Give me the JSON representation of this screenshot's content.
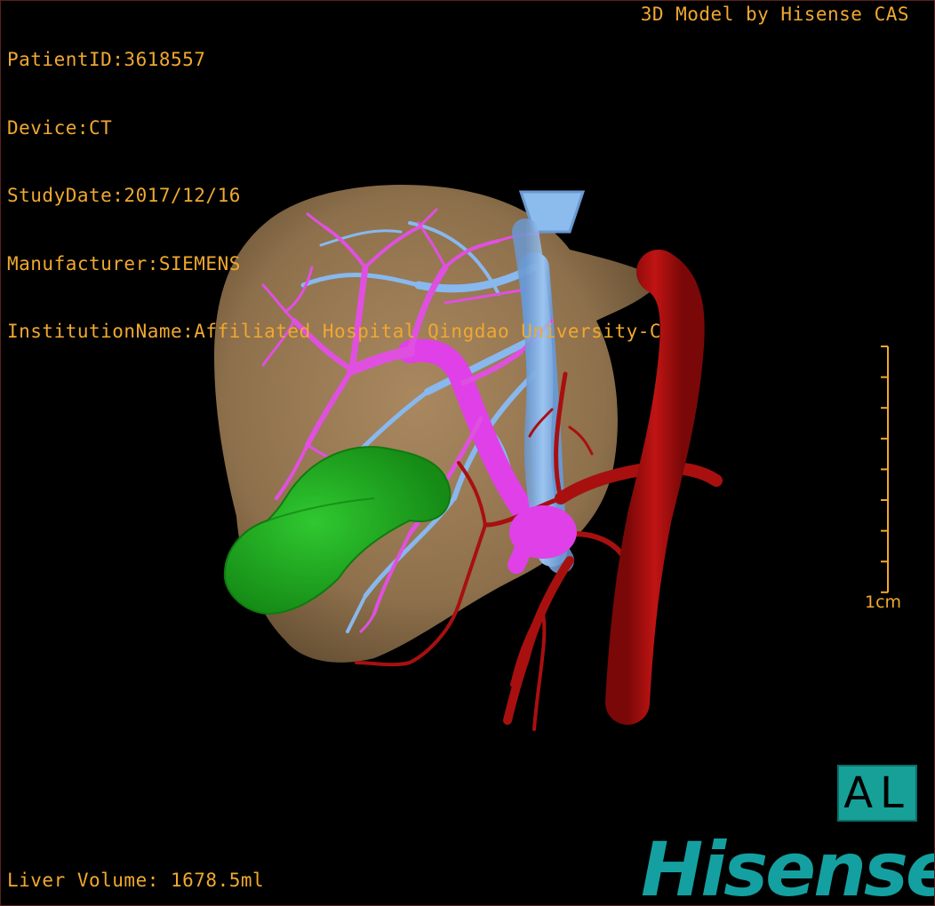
{
  "header": {
    "patient_id": "PatientID:3618557",
    "device": "Device:CT",
    "study_date": "StudyDate:2017/12/16",
    "manufacturer": "Manufacturer:SIEMENS",
    "institution": "InstitutionName:Affiliated Hospital Qingdao University-C"
  },
  "credit": "3D Model by Hisense CAS",
  "footer": {
    "liver_volume": "Liver Volume: 1678.5ml"
  },
  "scale_bar": {
    "label": "1cm"
  },
  "orientation_cube": {
    "label": "AL"
  },
  "brand": {
    "logo_text": "Hisense"
  },
  "colors": {
    "overlay_text": "#f0a830",
    "liver": "#a08058",
    "hepatic_vein": "#e050e0",
    "portal_vein": "#80b0e8",
    "artery": "#b01010",
    "tumor": "#20b020",
    "brand": "#14a0a0"
  }
}
